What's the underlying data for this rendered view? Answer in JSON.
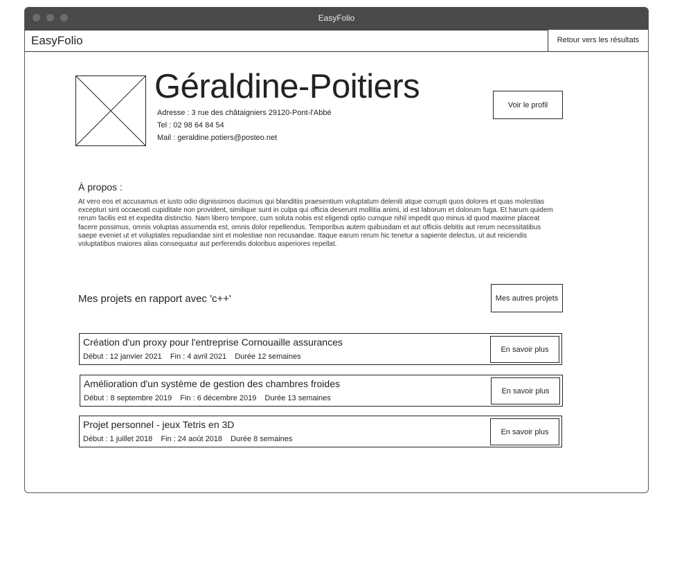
{
  "window": {
    "title": "EasyFolio"
  },
  "navbar": {
    "brand": "EasyFolio",
    "back_label": "Retour vers les résultats"
  },
  "profile": {
    "name": "Géraldine-Poitiers",
    "address": "Adresse : 3 rue des châtaigniers  29120-Pont-l'Abbé",
    "phone": "Tel : 02 98 64 84 54",
    "mail": "Mail : geraldine.potiers@posteo.net",
    "view_profile_label": "Voir le profil"
  },
  "about": {
    "title": "À propos :",
    "text": "At vero eos et accusamus et iusto odio dignissimos ducimus qui blanditiis praesentium voluptatum deleniti atque corrupti quos dolores et quas molestias excepturi sint occaecati cupiditate non provident, similique sunt in culpa qui officia deserunt mollitia animi, id est laborum et dolorum fuga. Et harum quidem rerum facilis est et expedita distinctio. Nam libero tempore, cum soluta nobis est eligendi optio cumque nihil impedit quo minus id quod maxime placeat facere possimus, omnis voluptas assumenda est, omnis dolor repellendus. Temporibus autem quibusdam et aut officiis debitis aut rerum necessitatibus saepe eveniet ut et voluptates repudiandae sint et molestiae non recusandae. Itaque earum rerum hic tenetur a sapiente delectus, ut aut reiciendis voluptatibus maiores alias consequatur aut perferendis doloribus asperiores repellat."
  },
  "projects": {
    "title": "Mes projets en rapport avec 'c++'",
    "other_label": "Mes autres projets",
    "items": [
      {
        "title": "Création d'un proxy pour l'entreprise Cornouaille assurances",
        "start": "Début : 12 janvier 2021",
        "end": "Fin : 4 avril 2021",
        "duration": "Durée 12 semaines",
        "more_label": "En savoir plus"
      },
      {
        "title": "Amélioration d'un système de gestion des chambres froides",
        "start": "Début : 8 septembre 2019",
        "end": "Fin : 6 décembre 2019",
        "duration": "Durée 13 semaines",
        "more_label": "En savoir plus"
      },
      {
        "title": "Projet personnel - jeux Tetris en 3D",
        "start": "Début : 1 juillet 2018",
        "end": "Fin : 24 août 2018",
        "duration": "Durée 8 semaines",
        "more_label": "En savoir plus"
      }
    ]
  }
}
